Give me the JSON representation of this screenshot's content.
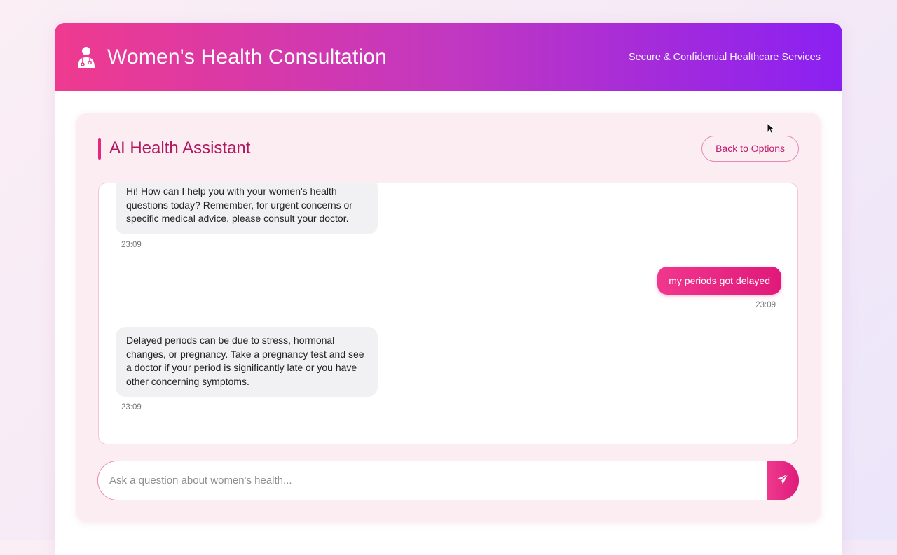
{
  "header": {
    "title": "Women's Health Consultation",
    "tagline": "Secure & Confidential Healthcare Services",
    "icon": "doctor-icon"
  },
  "panel": {
    "title": "AI Health Assistant",
    "back_label": "Back to Options"
  },
  "messages": [
    {
      "role": "assistant",
      "text": "Hi! How can I help you with your women's health questions today? Remember, for urgent concerns or specific medical advice, please consult your doctor.",
      "time": "23:09"
    },
    {
      "role": "user",
      "text": "my periods got delayed",
      "time": "23:09"
    },
    {
      "role": "assistant",
      "text": "Delayed periods can be due to stress, hormonal changes, or pregnancy. Take a pregnancy test and see a doctor if your period is significantly late or you have other concerning symptoms.",
      "time": "23:09"
    }
  ],
  "composer": {
    "placeholder": "Ask a question about women's health...",
    "value": "",
    "send_icon": "paper-plane-icon"
  },
  "colors": {
    "accent": "#e8267f",
    "header_start": "#ef3a8f",
    "header_end": "#8a20f2",
    "panel_bg": "#fcedf2"
  }
}
